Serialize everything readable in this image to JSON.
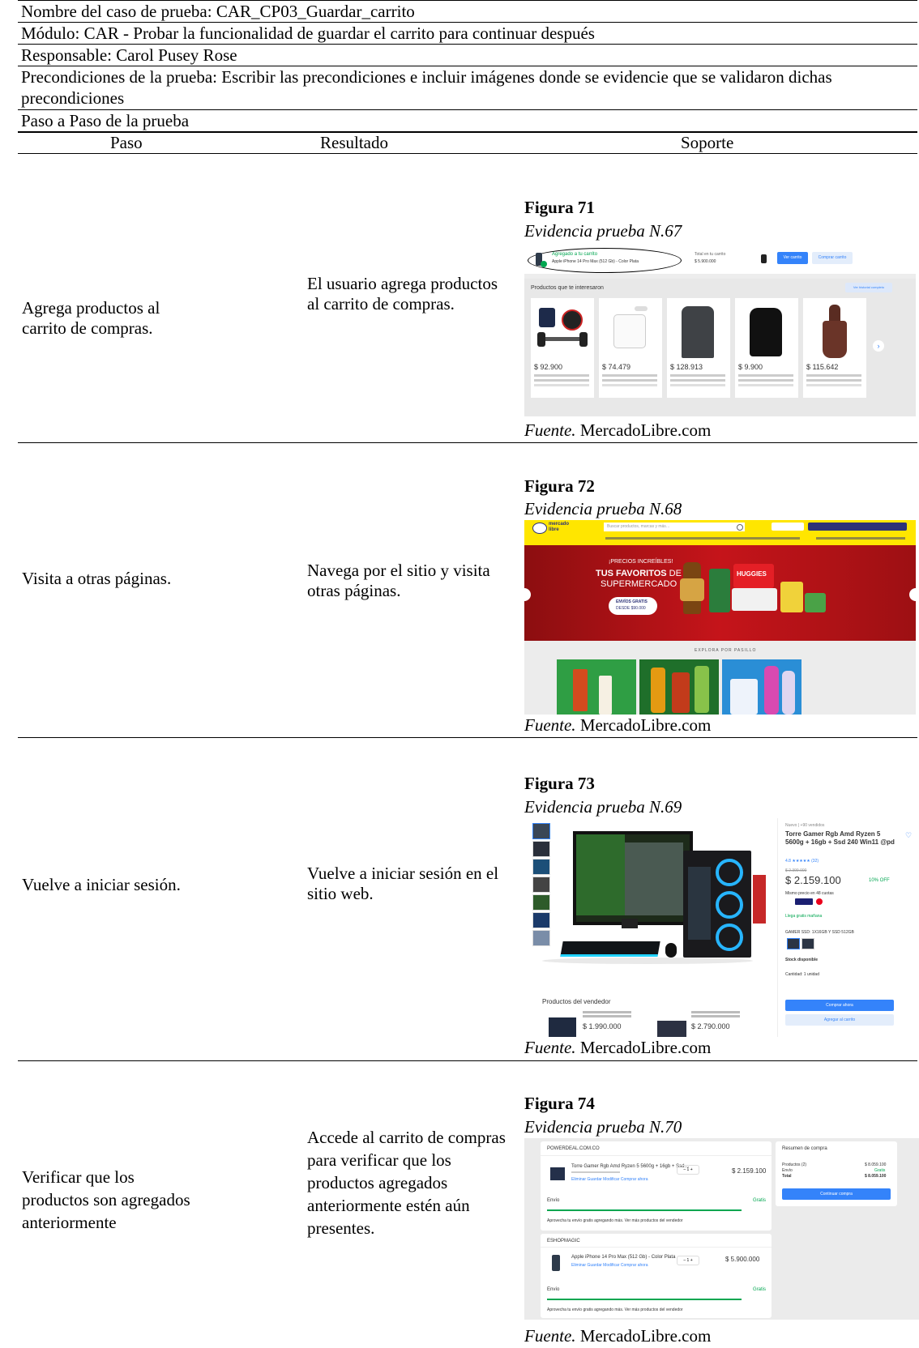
{
  "header": {
    "case_name": "Nombre del caso de prueba: CAR_CP03_Guardar_carrito",
    "module": "Módulo: CAR - Probar la funcionalidad de guardar el carrito para continuar después",
    "owner": "Responsable: Carol Pusey Rose",
    "preconditions": "Precondiciones de la prueba: Escribir las precondiciones e incluir imágenes donde se evidencie que se validaron dichas precondiciones",
    "steps_title": "Paso a Paso de la prueba"
  },
  "columns": {
    "step": "Paso",
    "result": "Resultado",
    "support": "Soporte"
  },
  "source_label": "Fuente.",
  "source_value": "MercadoLibre.com",
  "rows": [
    {
      "step": "Agrega productos al carrito de compras.",
      "result": "El usuario agrega productos al carrito de compras.",
      "figure_number": "Figura 71",
      "figure_title": "Evidencia prueba N.67",
      "screenshot": {
        "added_label": "Agregado a tu carrito",
        "added_item": "Apple iPhone 14 Pro Max (512 Gb) - Color Plata",
        "cart_total_label": "Total en tu carrito",
        "cart_total": "$ 5.900.000",
        "see_cart": "Ver carrito",
        "buy_cart": "Comprar carrito",
        "section_title": "Productos que te interesaron",
        "history_link": "Ver historial completo",
        "prices": [
          "$ 92.900",
          "$ 74.479",
          "$ 128.913",
          "$ 9.900",
          "$ 115.642"
        ]
      }
    },
    {
      "step": "Visita a otras páginas.",
      "result": "Navega por el sitio y visita otras páginas.",
      "figure_number": "Figura 72",
      "figure_title": "Evidencia prueba N.68",
      "screenshot": {
        "logo_top": "mercado",
        "logo_bottom": "libre",
        "search_placeholder": "Buscar productos, marcas y más…",
        "banner_small": "¡PRECIOS INCREÍBLES!",
        "banner_big_1": "TUS FAVORITOS",
        "banner_big_2": "DE",
        "banner_big_3": "SUPERMERCADO",
        "pill_1": "ENVÍOS GRATIS",
        "pill_2": "DESDE $90.000",
        "brand": "HUGGIES",
        "explore": "EXPLORA POR PASILLO"
      }
    },
    {
      "step": "Vuelve a iniciar sesión.",
      "result": "Vuelve a iniciar sesión en el sitio web.",
      "figure_number": "Figura 73",
      "figure_title": "Evidencia prueba N.69",
      "screenshot": {
        "condition": "Nuevo | +90 vendidos",
        "product_title": "Torre Gamer Rgb Amd Ryzen 5 5600g + 16gb + Ssd 240 Win11 @pd",
        "rating": "4.8 ★★★★★ (32)",
        "old_price": "$ 2.399.000",
        "price": "$ 2.159.100",
        "discount": "10% OFF",
        "installments": "Mismo precio en 48 cuotas",
        "delivery": "Llega gratis mañana",
        "variant": "GAMER SSD: 1X16GB Y SSD 512GB",
        "stock": "Stock disponible",
        "quantity": "Cantidad: 1 unidad",
        "buy_now": "Comprar ahora",
        "add_cart": "Agregar al carrito",
        "seller_products": "Productos del vendedor",
        "seller_price_1": "$ 1.990.000",
        "seller_price_2": "$ 2.790.000"
      }
    },
    {
      "step": "Verificar que los productos son agregados anteriormente",
      "result": "Accede al carrito de compras para verificar que los productos agregados anteriormente estén aún presentes.",
      "figure_number": "Figura 74",
      "figure_title": "Evidencia prueba N.70",
      "screenshot": {
        "seller_1": "POWERDEAL.COM.CO",
        "item_1": "Torre Gamer Rgb Amd Ryzen 5 5600g + 16gb + Ssd…",
        "item_1_price": "$ 2.159.100",
        "actions": "Eliminar   Guardar   Modificar   Comprar ahora",
        "shipping": "Envío",
        "free": "Gratis",
        "promo": "Aprovecha tu envío gratis agregando más. Ver más productos del vendedor",
        "seller_2": "ESHOPMAGIC",
        "item_2": "Apple iPhone 14 Pro Max (512 Gb) - Color Plata",
        "item_2_price": "$ 5.900.000",
        "summary_title": "Resumen de compra",
        "sum_products": "Productos (2)",
        "sum_products_val": "$ 8.059.100",
        "sum_ship": "Envío",
        "sum_ship_val": "Gratis",
        "sum_total": "Total",
        "sum_total_val": "$ 8.059.100",
        "continue": "Continuar compra"
      }
    }
  ]
}
